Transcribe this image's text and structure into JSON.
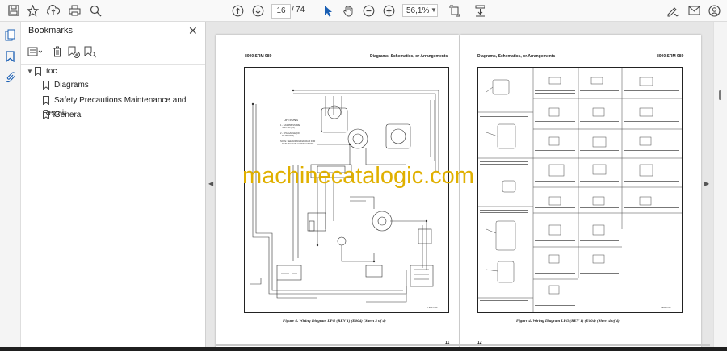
{
  "toolbar": {
    "icons": [
      "save-icon",
      "bookmark-star-icon",
      "upload-icon",
      "print-icon",
      "zoom-search-icon",
      "page-up-icon",
      "page-down-icon",
      "select-cursor-icon",
      "hand-icon",
      "zoom-out-icon",
      "zoom-in-icon",
      "fit-page-icon",
      "scroll-mode-icon",
      "sign-icon",
      "email-icon",
      "account-icon"
    ],
    "current_page": "16",
    "page_separator": "/",
    "total_pages": "74",
    "zoom": "56,1%"
  },
  "bookmarks": {
    "title": "Bookmarks",
    "root": "toc",
    "items": [
      {
        "label": "Diagrams"
      },
      {
        "label": "Safety Precautions Maintenance and Repair"
      },
      {
        "label": "General"
      }
    ]
  },
  "document": {
    "left_page": {
      "header_left": "8000 SRM 989",
      "header_right": "Diagrams, Schematics, or Arrangements",
      "options_title": "OPTIONS",
      "options_lines": [
        "1 - GAS PRESSURE\n   SWITCH (14)",
        "2 - LPG GAUGE (ON\n   PLATFORM)",
        "NOTE: SEE WIRING DIAGRAM FOR\n   DASH TO DASH CONNECTIONS."
      ],
      "caption": "Figure 4.  Wiring Diagram LPG (REV 1) (E004) (Sheet 3 of 4)",
      "page_number": "11",
      "figure_id": "790F7/01"
    },
    "right_page": {
      "header_left": "Diagrams, Schematics, or Arrangements",
      "header_right": "8000 SRM 989",
      "caption": "Figure 4.  Wiring Diagram LPG (REV 1) (E004) (Sheet 4 of 4)",
      "page_number": "12",
      "figure_id": "790F7/02"
    },
    "watermark": "machinecatalogic.com"
  },
  "colors": {
    "watermark": "#e0b000",
    "toolbar_bg": "#f9f9f9",
    "doc_bg": "#e6e6e6"
  }
}
